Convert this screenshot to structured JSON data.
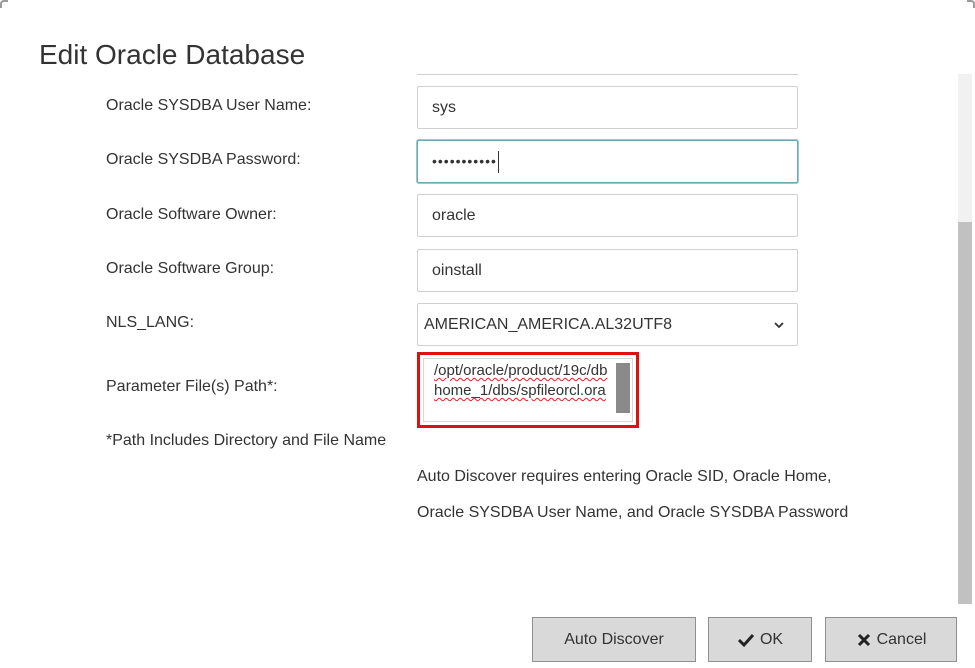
{
  "dialog": {
    "title": "Edit Oracle Database"
  },
  "form": {
    "sysdba_user": {
      "label": "Oracle SYSDBA User Name:",
      "value": "sys"
    },
    "sysdba_password": {
      "label": "Oracle SYSDBA Password:",
      "masked_value": "•••••••••••"
    },
    "software_owner": {
      "label": "Oracle Software Owner:",
      "value": "oracle"
    },
    "software_group": {
      "label": "Oracle Software Group:",
      "value": "oinstall"
    },
    "nls_lang": {
      "label": "NLS_LANG:",
      "selected": "AMERICAN_AMERICA.AL32UTF8"
    },
    "parameter_file": {
      "label": "Parameter File(s) Path*:",
      "value": "/opt/oracle/product/19c/dbhome_1/dbs/spfileorcl.ora"
    },
    "path_note": "*Path Includes Directory and File Name",
    "auto_discover_info_line1": "Auto Discover requires entering Oracle SID, Oracle Home,",
    "auto_discover_info_line2": "Oracle SYSDBA User Name, and Oracle SYSDBA Password"
  },
  "buttons": {
    "auto_discover": "Auto Discover",
    "ok": "OK",
    "cancel": "Cancel"
  },
  "colors": {
    "highlight_border": "#e01010",
    "focus_border": "#6aa9b5",
    "button_bg": "#d9d9d9"
  }
}
